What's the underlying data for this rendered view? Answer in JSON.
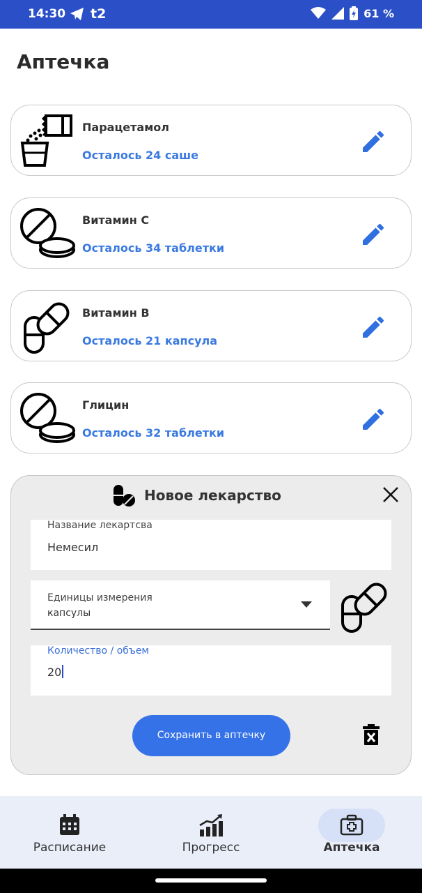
{
  "status_bar": {
    "time": "14:30",
    "carrier_badge": "t2",
    "battery_percent": "61 %"
  },
  "page": {
    "title": "Аптечка"
  },
  "medicines": [
    {
      "name": "Парацетамол",
      "remaining": "Осталось 24 саше",
      "icon": "sachet-icon"
    },
    {
      "name": "Витамин С",
      "remaining": "Осталось 34 таблетки",
      "icon": "tablet-icon"
    },
    {
      "name": "Витамин В",
      "remaining": "Осталось 21 капсула",
      "icon": "capsule-icon"
    },
    {
      "name": "Глицин",
      "remaining": "Осталось 32 таблетки",
      "icon": "tablet-icon"
    }
  ],
  "dialog": {
    "title": "Новое лекарство",
    "name_field": {
      "label": "Название лекартсва",
      "value": "Немесил"
    },
    "units_field": {
      "label": "Единицы измерения",
      "value": "капсулы"
    },
    "quantity_field": {
      "label": "Количество / объем",
      "value": "20"
    },
    "save_label": "Сохранить в аптечку"
  },
  "bottom_nav": {
    "items": [
      {
        "label": "Расписание",
        "icon": "calendar-icon",
        "active": false
      },
      {
        "label": "Прогресс",
        "icon": "chart-icon",
        "active": false
      },
      {
        "label": "Аптечка",
        "icon": "medkit-icon",
        "active": true
      }
    ]
  },
  "colors": {
    "status_bar": "#2a4fc7",
    "accent": "#3572e8",
    "remaining_text": "#3b7ae0",
    "nav_bg": "#e9eef9"
  }
}
